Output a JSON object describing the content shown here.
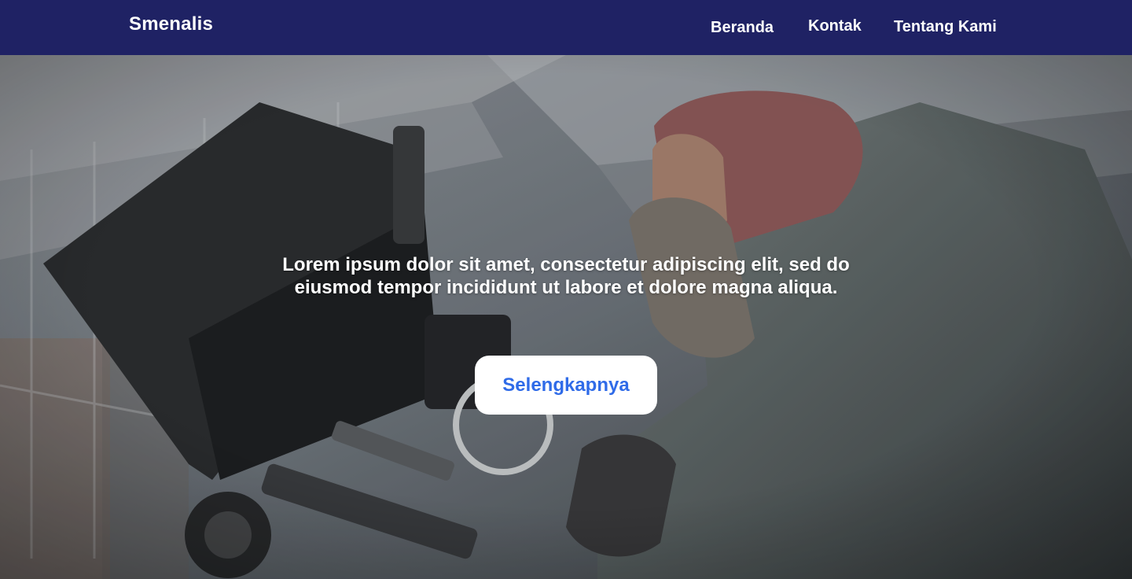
{
  "navbar": {
    "brand": "Smenalis",
    "links": [
      "Beranda",
      "Kontak",
      "Tentang Kami"
    ]
  },
  "hero": {
    "image_icon": "cameraman-photo",
    "text": "Lorem ipsum dolor sit amet, consectetur adipiscing elit, sed do eiusmod tempor incididunt ut labore et dolore magna aliqua.",
    "button_label": "Selengkapnya"
  },
  "colors": {
    "navbar_bg": "#1f2264",
    "button_bg": "#ffffff",
    "button_text": "#2f6be8",
    "text": "#ffffff"
  }
}
